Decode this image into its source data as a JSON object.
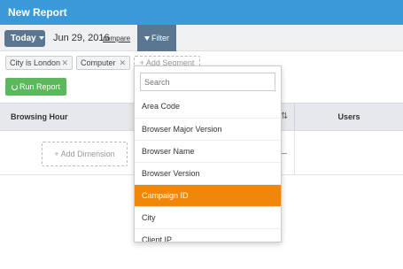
{
  "title": "New Report",
  "toolbar": {
    "today_label": "Today",
    "date": "Jun 29, 2016",
    "compare_label": "compare",
    "filter_label": "Filter"
  },
  "segments": {
    "chips": [
      "City is London",
      "Computer"
    ],
    "add_label": "+ Add Segment"
  },
  "run_report_label": "Run Report",
  "table": {
    "columns": [
      "Browsing Hour",
      "Users"
    ],
    "add_dimension_label": "+ Add Dimension"
  },
  "dropdown": {
    "search_placeholder": "Search",
    "items": [
      "Area Code",
      "Browser Major Version",
      "Browser Name",
      "Browser Version",
      "Campaign ID",
      "City",
      "Client IP"
    ],
    "selected": "Campaign ID",
    "highlight_color": "#f0860a"
  },
  "colors": {
    "header": "#3a9ad9",
    "button": "#5b7691",
    "run_button": "#5cb85c"
  }
}
